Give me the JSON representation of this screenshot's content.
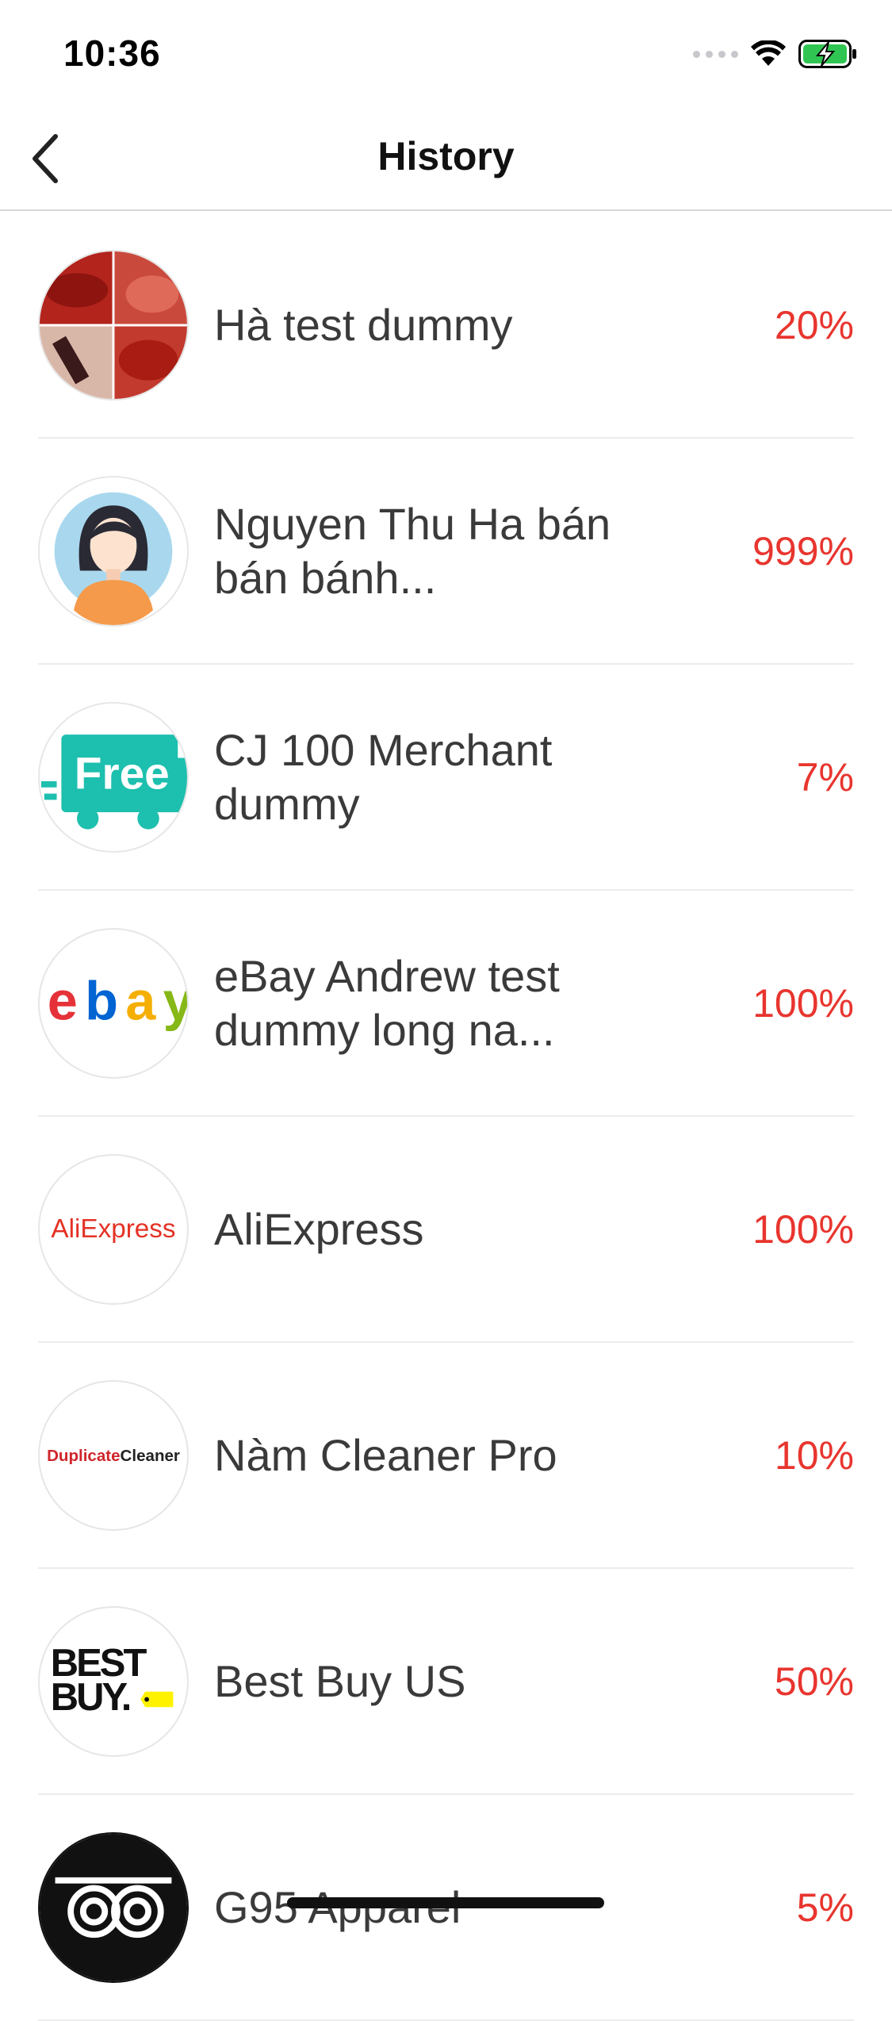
{
  "status_bar": {
    "time": "10:36"
  },
  "nav": {
    "title": "History"
  },
  "history": [
    {
      "name": "Hà test dummy",
      "percent": "20%"
    },
    {
      "name": "Nguyen Thu Ha bán bán bánh...",
      "percent": "999%"
    },
    {
      "name": "CJ 100 Merchant dummy",
      "percent": "7%"
    },
    {
      "name": "eBay Andrew test dummy long na...",
      "percent": "100%"
    },
    {
      "name": "AliExpress",
      "percent": "100%"
    },
    {
      "name": "Nàm Cleaner Pro",
      "percent": "10%"
    },
    {
      "name": "Best Buy US",
      "percent": "50%"
    },
    {
      "name": "G95 Apparel",
      "percent": "5%"
    }
  ],
  "logos": {
    "free_text": "Free",
    "ebay": [
      "e",
      "b",
      "a",
      "y"
    ],
    "aliexpress": "AliExpress",
    "duplicate_cleaner": [
      "Duplicate",
      "Cleaner"
    ],
    "bestbuy": [
      "BEST",
      "BUY."
    ]
  },
  "colors": {
    "accent_percent": "#e8352e",
    "battery_green": "#30c552",
    "free_teal": "#1dbfae",
    "ebay_red": "#e53238",
    "ebay_blue": "#0064d2",
    "ebay_yellow": "#f5af02",
    "ebay_green": "#86b817",
    "aliexpress_orange": "#e43225",
    "bestbuy_yellow": "#fff200"
  }
}
